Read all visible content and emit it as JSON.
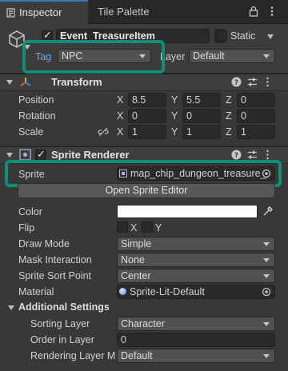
{
  "tabs": {
    "inspector": "Inspector",
    "tile_palette": "Tile Palette"
  },
  "header": {
    "object_name": "Event_TreasureItem",
    "static_label": "Static",
    "tag_label": "Tag",
    "tag_value": "NPC",
    "layer_label": "Layer",
    "layer_value": "Default"
  },
  "transform": {
    "title": "Transform",
    "position_label": "Position",
    "rotation_label": "Rotation",
    "scale_label": "Scale",
    "axis_x": "X",
    "axis_y": "Y",
    "axis_z": "Z",
    "position": {
      "x": "8.5",
      "y": "5.5",
      "z": "0"
    },
    "rotation": {
      "x": "0",
      "y": "0",
      "z": "0"
    },
    "scale": {
      "x": "1",
      "y": "1",
      "z": "1"
    }
  },
  "sprite_renderer": {
    "title": "Sprite Renderer",
    "sprite_label": "Sprite",
    "sprite_value": "map_chip_dungeon_treasure_",
    "open_editor_label": "Open Sprite Editor",
    "color_label": "Color",
    "flip_label": "Flip",
    "flip_x": "X",
    "flip_y": "Y",
    "draw_mode_label": "Draw Mode",
    "draw_mode_value": "Simple",
    "mask_label": "Mask Interaction",
    "mask_value": "None",
    "sort_point_label": "Sprite Sort Point",
    "sort_point_value": "Center",
    "material_label": "Material",
    "material_value": "Sprite-Lit-Default",
    "additional_title": "Additional Settings",
    "sorting_layer_label": "Sorting Layer",
    "sorting_layer_value": "Character",
    "order_label": "Order in Layer",
    "order_value": "0",
    "rendering_layer_label": "Rendering Layer M",
    "rendering_layer_value": "Default"
  },
  "colors": {
    "highlight": "#0f8f78",
    "accent_blue": "#3a79bb",
    "tag_label_blue": "#6aa7e6"
  }
}
